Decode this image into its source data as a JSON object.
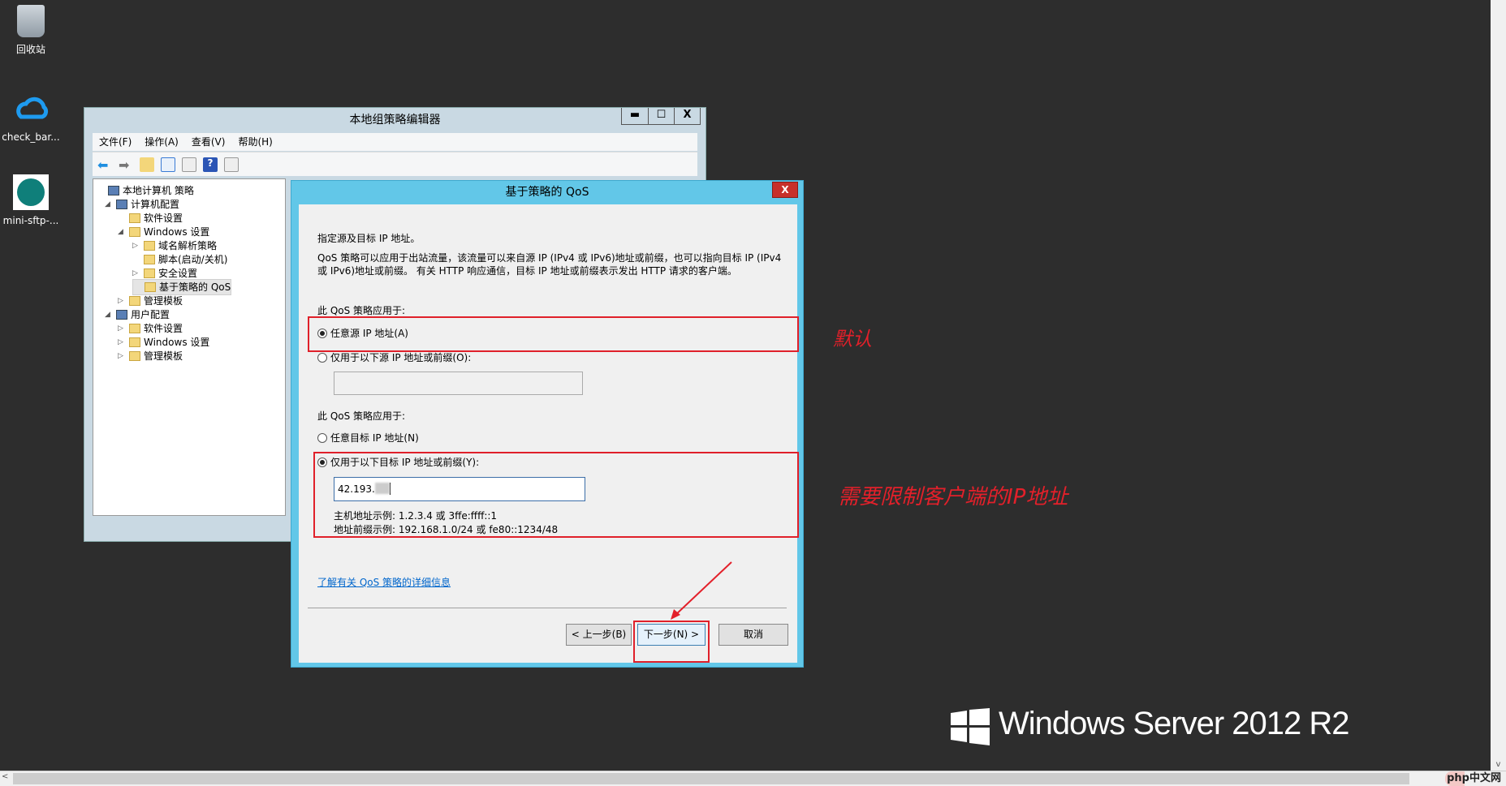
{
  "desktop": {
    "icons": [
      {
        "label": "回收站",
        "icon": "recycle-bin-icon"
      },
      {
        "label": "check_bar...",
        "icon": "cloud-icon"
      },
      {
        "label": "mini-sftp-...",
        "icon": "mini-sftp-icon"
      }
    ],
    "branding": "Windows Server 2012 R2",
    "watermark": "php中文网"
  },
  "gpe": {
    "title": "本地组策略编辑器",
    "menu": [
      "文件(F)",
      "操作(A)",
      "查看(V)",
      "帮助(H)"
    ],
    "tree": [
      {
        "label": "本地计算机 策略",
        "level": 0,
        "arrow": ""
      },
      {
        "label": "计算机配置",
        "level": 1,
        "arrow": "◢"
      },
      {
        "label": "软件设置",
        "level": 2,
        "arrow": ""
      },
      {
        "label": "Windows 设置",
        "level": 2,
        "arrow": "◢"
      },
      {
        "label": "域名解析策略",
        "level": 3,
        "arrow": "▷"
      },
      {
        "label": "脚本(启动/关机)",
        "level": 3,
        "arrow": ""
      },
      {
        "label": "安全设置",
        "level": 3,
        "arrow": "▷"
      },
      {
        "label": "基于策略的 QoS",
        "level": 3,
        "arrow": "",
        "selected": true
      },
      {
        "label": "管理模板",
        "level": 2,
        "arrow": "▷"
      },
      {
        "label": "用户配置",
        "level": 1,
        "arrow": "◢"
      },
      {
        "label": "软件设置",
        "level": 2,
        "arrow": "▷"
      },
      {
        "label": "Windows 设置",
        "level": 2,
        "arrow": "▷"
      },
      {
        "label": "管理模板",
        "level": 2,
        "arrow": "▷"
      }
    ]
  },
  "dialog": {
    "title": "基于策略的 QoS",
    "close": "X",
    "heading": "指定源及目标 IP 地址。",
    "desc1": "QoS 策略可以应用于出站流量，该流量可以来自源 IP (IPv4 或 IPv6)地址或前缀，也可以指向目标 IP (IPv4",
    "desc2": "或 IPv6)地址或前缀。 有关 HTTP 响应通信，目标 IP 地址或前缀表示发出 HTTP 请求的客户端。",
    "source_label": "此 QoS 策略应用于:",
    "source_any": "任意源 IP 地址(A)",
    "source_only": "仅用于以下源 IP 地址或前缀(O):",
    "source_value": "",
    "dest_label": "此 QoS 策略应用于:",
    "dest_any": "任意目标 IP 地址(N)",
    "dest_only": "仅用于以下目标 IP 地址或前缀(Y):",
    "dest_value": "42.193.",
    "example_host": "主机地址示例: 1.2.3.4 或 3ffe:ffff::1",
    "example_prefix": "地址前缀示例: 192.168.1.0/24 或 fe80::1234/48",
    "link": "了解有关 QoS 策略的详细信息",
    "back": "< 上一步(B)",
    "next": "下一步(N) >",
    "cancel": "取消"
  },
  "annotations": {
    "default": "默认",
    "restrict": "需要限制客户端的IP地址"
  },
  "colors": {
    "desktop": "#2d2d2d",
    "dialog_frame": "#62c7e8",
    "annotation": "#e3202a"
  }
}
